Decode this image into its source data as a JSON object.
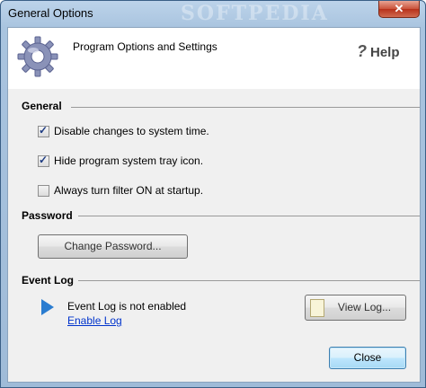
{
  "window": {
    "title": "General Options",
    "watermark": "SOFTPEDIA",
    "close_glyph": "✕"
  },
  "header": {
    "title": "Program Options and Settings",
    "icon": "gear-icon",
    "help_glyph": "?",
    "help_label": "Help"
  },
  "general": {
    "label": "General",
    "options": [
      {
        "label": "Disable changes to system time.",
        "checked": true
      },
      {
        "label": "Hide program system tray icon.",
        "checked": true
      },
      {
        "label": "Always turn filter ON at startup.",
        "checked": false
      }
    ]
  },
  "password": {
    "label": "Password",
    "change_button": "Change Password..."
  },
  "event_log": {
    "label": "Event Log",
    "status": "Event Log is not enabled",
    "enable_link": "Enable Log",
    "view_button": "View Log..."
  },
  "footer": {
    "close_button": "Close"
  },
  "colors": {
    "accent": "#2a7cd0",
    "link": "#0033cc"
  }
}
